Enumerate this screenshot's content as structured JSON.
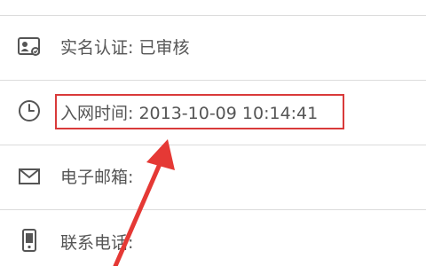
{
  "profile_rows": [
    {
      "icon": "id-card-icon",
      "label": "实名认证: 已审核"
    },
    {
      "icon": "clock-icon",
      "label": "入网时间: 2013-10-09 10:14:41"
    },
    {
      "icon": "envelope-icon",
      "label": "电子邮箱:"
    },
    {
      "icon": "phone-icon",
      "label": "联系电话:"
    }
  ],
  "annotation": {
    "highlight_color": "#d93a3a",
    "arrow_color": "#e53935",
    "highlighted_row": "入网时间: 2013-10-09 10:14:41"
  }
}
